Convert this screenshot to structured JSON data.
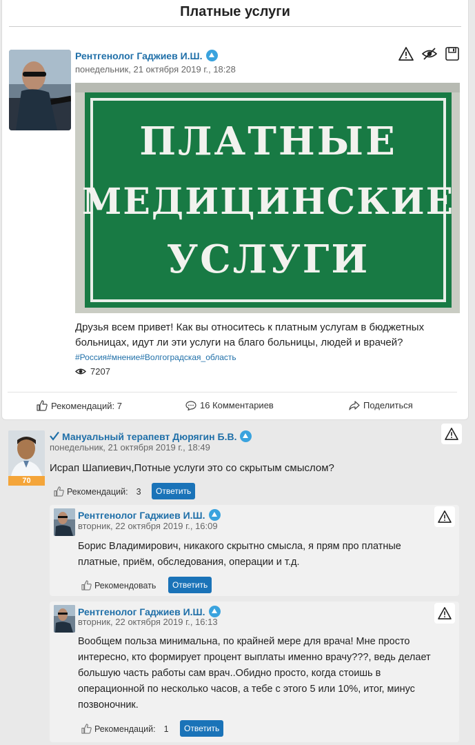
{
  "page": {
    "title": "Платные услуги"
  },
  "post": {
    "author": "Рентгенолог Гаджиев И.Ш.",
    "timestamp": "понедельник, 21 октября 2019 г., 18:28",
    "image_text": {
      "line1": "ПЛАТНЫЕ",
      "line2": "МЕДИЦИНСКИЕ",
      "line3": "УСЛУГИ"
    },
    "text": "Друзья всем привет! Как вы относитесь к платным услугам в бюджетных больницах, идут ли эти услуги на благо больницы, людей и врачей?",
    "hashtags": "#Россия#мнение#Волгоградская_область",
    "views": "7207",
    "footer": {
      "recommend_label": "Рекомендаций: 7",
      "comments_label": "16 Комментариев",
      "share_label": "Поделиться"
    }
  },
  "comments": [
    {
      "author": "Мануальный терапевт Дюрягин Б.В.",
      "timestamp": "понедельник, 21 октября 2019 г., 18:49",
      "rating": "70",
      "text": "Исрап Шапиевич,Потные услуги это со скрытым смыслом?",
      "recommend_label": "Рекомендаций:",
      "recommend_count": "3",
      "reply_label": "Ответить"
    },
    {
      "author": "Рентгенолог Гаджиев И.Ш.",
      "timestamp": "вторник, 22 октября 2019 г., 16:09",
      "text": "Борис Владимирович, никакого скрытно смысла, я прям про платные платные, приём, обследования, операции и т.д.",
      "recommend_label": "Рекомендовать",
      "reply_label": "Ответить"
    },
    {
      "author": "Рентгенолог Гаджиев И.Ш.",
      "timestamp": "вторник, 22 октября 2019 г., 16:13",
      "text": "Вообщем польза минимальна, по крайней мере для врача! Мне просто интересно, кто формирует процент выплаты именно врачу???, ведь делает большую часть работы сам врач..Обидно просто, когда стоишь в операционной по несколько часов, а тебе с этого 5 или 10%, итог, минус позвоночник.",
      "recommend_label": "Рекомендаций:",
      "recommend_count": "1",
      "reply_label": "Ответить"
    }
  ],
  "colors": {
    "link": "#1f6fa8",
    "button": "#1a73b8",
    "badge": "#3aa3de",
    "rating": "#f4a53a",
    "sign_green": "#1e8a4c"
  }
}
